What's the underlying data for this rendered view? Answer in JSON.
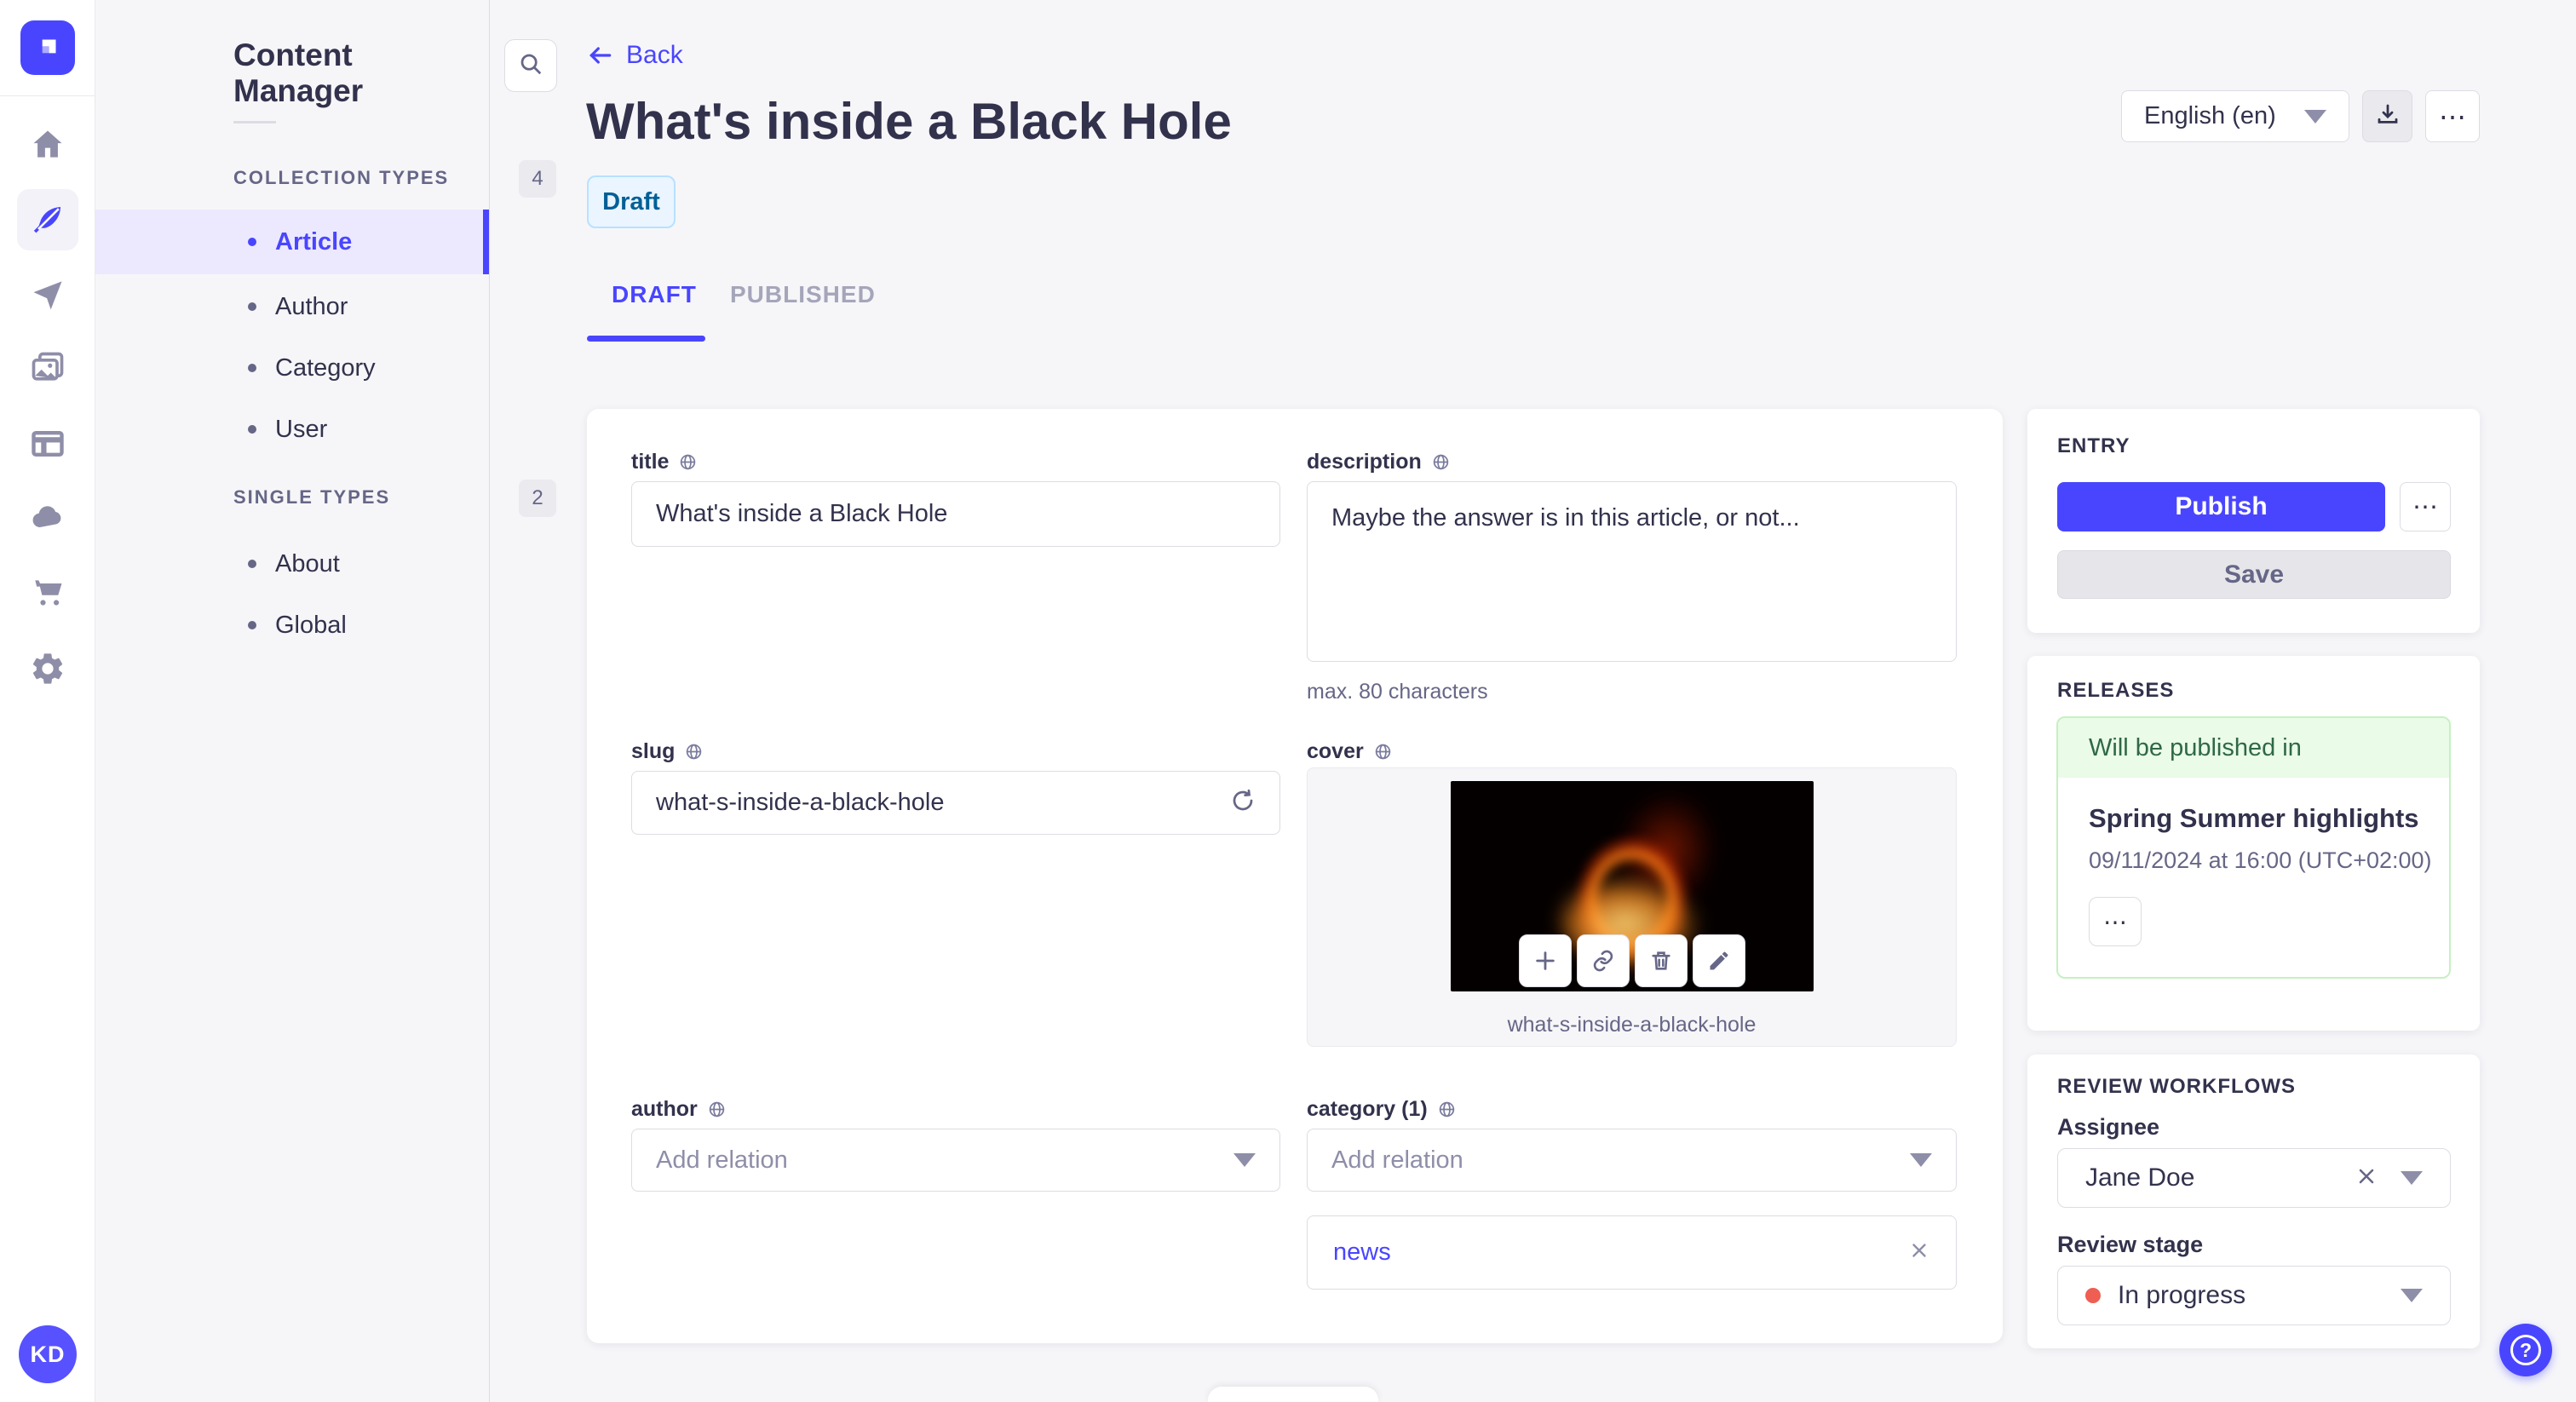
{
  "colors": {
    "accent": "#4945ff",
    "page_bg": "#f6f6f9",
    "draft_badge_bg": "#eaf5ff",
    "draft_badge_border": "#b8e1ff",
    "draft_badge_text": "#006096",
    "success_bg": "#eafbe7",
    "success_border": "#c6f0c2",
    "success_text": "#2f6846",
    "stage_dot": "#ee5e52",
    "text_dark": "#32324d",
    "text_muted": "#666687",
    "icon_gray": "#8e8ea9"
  },
  "icons": {
    "more": "⋯"
  },
  "sidebar": {
    "user_initials": "KD"
  },
  "subnav": {
    "title": "Content Manager",
    "sections": [
      {
        "label": "COLLECTION TYPES",
        "count": "4",
        "items": [
          {
            "label": "Article"
          },
          {
            "label": "Author"
          },
          {
            "label": "Category"
          },
          {
            "label": "User"
          }
        ]
      },
      {
        "label": "SINGLE TYPES",
        "count": "2",
        "items": [
          {
            "label": "About"
          },
          {
            "label": "Global"
          }
        ]
      }
    ]
  },
  "header": {
    "back_label": "Back",
    "title": "What's inside a Black Hole",
    "status_badge": "Draft",
    "locale": "English (en)",
    "tabs": [
      {
        "label": "DRAFT"
      },
      {
        "label": "PUBLISHED"
      }
    ]
  },
  "form": {
    "title": {
      "label": "title",
      "value": "What's inside a Black Hole"
    },
    "description": {
      "label": "description",
      "value": "Maybe the answer is in this article, or not...",
      "helper": "max. 80 characters"
    },
    "slug": {
      "label": "slug",
      "value": "what-s-inside-a-black-hole"
    },
    "cover": {
      "label": "cover",
      "caption": "what-s-inside-a-black-hole"
    },
    "author": {
      "label": "author",
      "placeholder": "Add relation"
    },
    "category": {
      "label": "category (1)",
      "placeholder": "Add relation",
      "relation": "news"
    }
  },
  "entry_panel": {
    "title": "ENTRY",
    "publish_label": "Publish",
    "save_label": "Save"
  },
  "releases_panel": {
    "title": "RELEASES",
    "status": "Will be published in",
    "release_name": "Spring Summer highlights",
    "release_date": "09/11/2024 at 16:00 (UTC+02:00)"
  },
  "review_panel": {
    "title": "REVIEW WORKFLOWS",
    "assignee_label": "Assignee",
    "assignee_value": "Jane Doe",
    "stage_label": "Review stage",
    "stage_value": "In progress"
  }
}
